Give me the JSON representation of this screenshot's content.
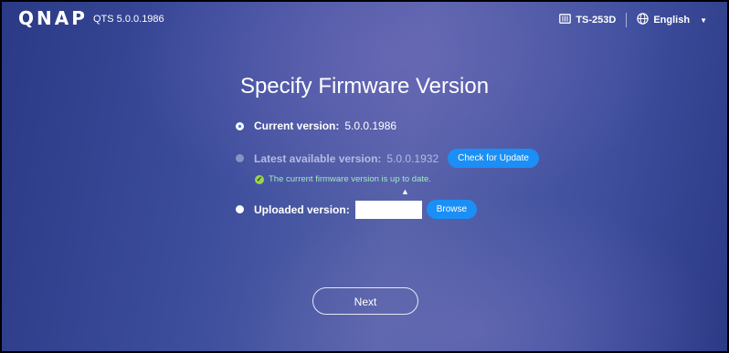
{
  "header": {
    "logo": "QNAP",
    "version_label": "QTS 5.0.0.1986",
    "device_name": "TS-253D",
    "language": "English"
  },
  "main": {
    "title": "Specify Firmware Version",
    "current": {
      "label": "Current version:",
      "value": "5.0.0.1986"
    },
    "latest": {
      "label": "Latest available version:",
      "value": "5.0.0.1932",
      "button": "Check for Update"
    },
    "status_message": "The current firmware version is up to date.",
    "uploaded": {
      "label": "Uploaded version:",
      "input_value": "",
      "button": "Browse"
    },
    "next_button": "Next"
  },
  "icons": {
    "device": "server-icon",
    "language": "globe-icon",
    "status": "check-circle-icon"
  },
  "colors": {
    "accent_button": "#1b8ff5",
    "status_text": "#9fe8c4",
    "status_icon": "#9bd34f"
  }
}
